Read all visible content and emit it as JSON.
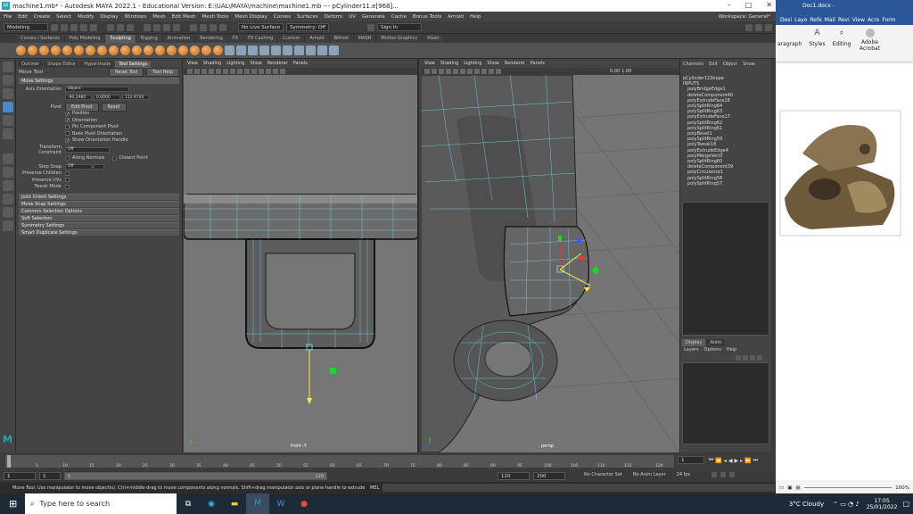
{
  "maya": {
    "title": "machine1.mb* - Autodesk MAYA 2022.1 - Educational Version: E:\\UAL\\MAYA\\machine\\machine1.mb  ---  pCylinder11.e[968]...",
    "logo_letter": "M",
    "menu": [
      "File",
      "Edit",
      "Create",
      "Select",
      "Modify",
      "Display",
      "Windows",
      "Mesh",
      "Edit Mesh",
      "Mesh Tools",
      "Mesh Display",
      "Curves",
      "Surfaces",
      "Deform",
      "UV",
      "Generate",
      "Cache",
      "Bonus Tools",
      "Arnold",
      "Help"
    ],
    "workspace_label": "Workspace: General*",
    "status": {
      "mode": "Modeling",
      "live_surface": "No Live Surface",
      "symmetry": "Symmetry: Off",
      "sign_in": "Sign In"
    },
    "shelf_tabs": [
      "Curves / Surfaces",
      "Poly Modeling",
      "Sculpting",
      "Rigging",
      "Animation",
      "Rendering",
      "FX",
      "FX Caching",
      "Custom",
      "Arnold",
      "Bifrost",
      "MASH",
      "Motion Graphics",
      "XGen"
    ],
    "shelf_active": "Sculpting",
    "tool_settings": {
      "tabs": [
        "Outliner",
        "Shape Editor",
        "Hypershade",
        "Tool Settings"
      ],
      "active_tab": "Tool Settings",
      "tool_name": "Move Tool",
      "reset_label": "Reset Tool",
      "help_label": "Tool Help",
      "move_settings": "Move Settings",
      "axis_orientation_label": "Axis Orientation",
      "axis_orientation_value": "Object",
      "xyz": [
        "-90.2980",
        "0.0000",
        "112.9740"
      ],
      "pivot_label": "Pivot",
      "edit_pivot": "Edit Pivot",
      "reset": "Reset",
      "checks": [
        {
          "label": "Position",
          "checked": true
        },
        {
          "label": "Orientation",
          "checked": true
        },
        {
          "label": "Pin Component Pivot",
          "checked": false
        },
        {
          "label": "Bake Pivot Orientation",
          "checked": false
        },
        {
          "label": "Show Orientation Handle",
          "checked": true
        }
      ],
      "transform_constraint_label": "Transform Constraint",
      "transform_constraint_value": "Off",
      "along_normals": "Along Normals",
      "closest_point": "Closest Point",
      "step_snap_label": "Step Snap",
      "step_snap_value": "Off",
      "preserve_children": "Preserve Children",
      "preserve_uvs": "Preserve UVs",
      "tweak_mode": "Tweak Mode",
      "sections": [
        "Joint Orient Settings",
        "Move Snap Settings",
        "Common Selection Options",
        "Soft Selection",
        "Symmetry Settings",
        "Smart Duplicate Settings"
      ]
    },
    "viewport_menu": [
      "View",
      "Shading",
      "Lighting",
      "Show",
      "Renderer",
      "Panels"
    ],
    "vp_values": {
      "exposure": "0.00",
      "gamma": "1.00"
    },
    "left_vp_label": "front -Y",
    "right_vp_label": "persp",
    "channel_box": {
      "menu": [
        "Channels",
        "Edit",
        "Object",
        "Show"
      ],
      "shape": "pCylinder11Shape",
      "inputs_label": "INPUTS",
      "inputs": [
        "polyBridgeEdge1",
        "deleteComponent40",
        "polyExtrudeFace18",
        "polySplitRing64",
        "polySplitRing63",
        "polyExtrudeFace17",
        "polySplitRing62",
        "polySplitRing61",
        "polyBevel1",
        "polySplitRing59",
        "polyTweak18",
        "polyExtrudeEdge4",
        "polyMergeVert3",
        "polySplitRing60",
        "deleteComponent39",
        "polyCircularize1",
        "polySplitRing58",
        "polySplitRing57"
      ],
      "layer_tabs": [
        "Display",
        "Anim"
      ],
      "layer_menu": [
        "Layers",
        "Options",
        "Help"
      ]
    },
    "timeline": {
      "ticks": [
        "1",
        "5",
        "10",
        "15",
        "20",
        "25",
        "30",
        "35",
        "40",
        "45",
        "50",
        "55",
        "60",
        "65",
        "70",
        "75",
        "80",
        "85",
        "90",
        "95",
        "100",
        "105",
        "110",
        "115",
        "120"
      ],
      "current_frame": "1"
    },
    "range": {
      "start": "1",
      "start2": "1",
      "slider_start": "1",
      "slider_end": "120",
      "end": "120",
      "end2": "200",
      "character_set": "No Character Set",
      "anim_layer": "No Anim Layer",
      "fps": "24 fps"
    },
    "help_line": "Move Tool: Use manipulator to move object(s). Ctrl+middle-drag to move components along normals. Shift+drag manipulator axis or plane handle to extrude components or clone objects. Ctrl+Shift+drag to ...",
    "mel_label": "MEL"
  },
  "word": {
    "title": "Doc1.docx -",
    "tabs": [
      "Desi",
      "Layo",
      "Refe",
      "Mail",
      "Revi",
      "View",
      "Acro",
      "Form"
    ],
    "groups": [
      "aragraph",
      "Styles",
      "Editing",
      "Adobe Acrobat"
    ],
    "zoom": "100%"
  },
  "taskbar": {
    "search_placeholder": "Type here to search",
    "weather": "3°C Cloudy",
    "time": "17:05",
    "date": "25/01/2022"
  },
  "colors": {
    "maya_blue": "#2a9fb8",
    "wire": "#6fd0e8",
    "taskbar": "#1f2a38"
  }
}
